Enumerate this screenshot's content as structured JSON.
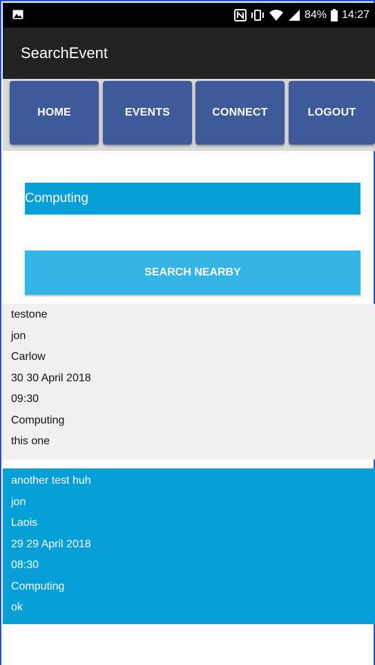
{
  "statusbar": {
    "battery": "84%",
    "time": "14:27"
  },
  "appbar": {
    "title": "SearchEvent"
  },
  "nav": {
    "items": [
      {
        "label": "HOME"
      },
      {
        "label": "EVENTS"
      },
      {
        "label": "CONNECT"
      },
      {
        "label": "LOGOUT"
      }
    ]
  },
  "search": {
    "value": "Computing",
    "button_label": "SEARCH NEARBY"
  },
  "events": [
    {
      "name": "testone",
      "user": "jon",
      "location": "Carlow",
      "date": "30 30 April 2018",
      "time": "09:30",
      "category": "Computing",
      "description": "this one"
    },
    {
      "name": "another test huh",
      "user": "jon",
      "location": "Laois",
      "date": "29 29 April 2018",
      "time": "08:30",
      "category": "Computing",
      "description": "ok"
    }
  ],
  "colors": {
    "nav_button": "#3f5a9b",
    "search_field": "#069fd8",
    "search_button": "#33b5e5",
    "appbar": "#212121"
  }
}
